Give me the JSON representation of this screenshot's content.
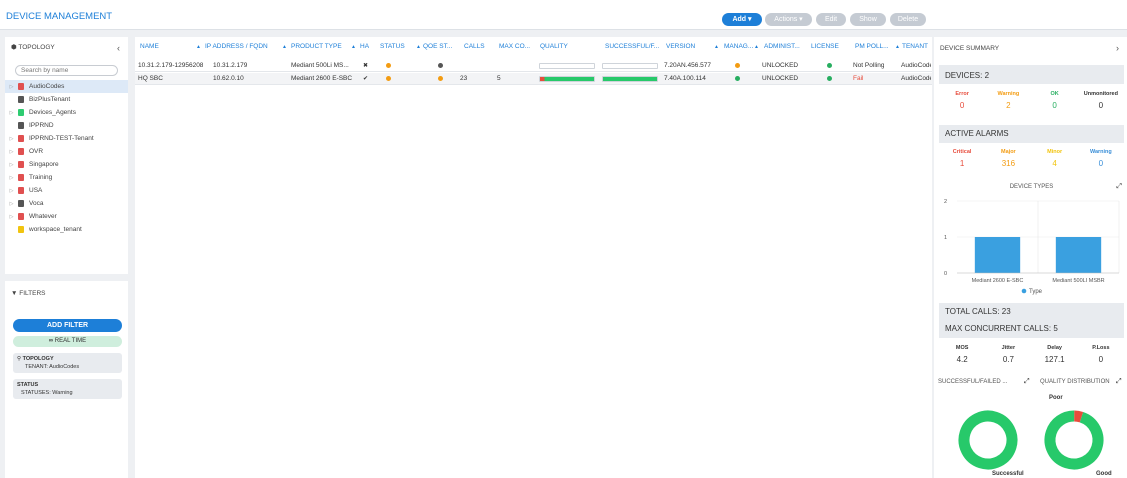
{
  "page_title": "DEVICE MANAGEMENT",
  "toolbar": {
    "add": "Add ▾",
    "actions": "Actions ▾",
    "edit": "Edit",
    "show": "Show",
    "delete": "Delete"
  },
  "topology": {
    "title": "TOPOLOGY",
    "search_placeholder": "Search by name",
    "items": [
      {
        "label": "AudioCodes",
        "color": "#e05050",
        "expand": true,
        "selected": true
      },
      {
        "label": "BizPlusTenant",
        "color": "#555555",
        "expand": false
      },
      {
        "label": "Devices_Agents",
        "color": "#2ecc71",
        "expand": true
      },
      {
        "label": "IPPRND",
        "color": "#555555",
        "expand": false
      },
      {
        "label": "IPPRND-TEST-Tenant",
        "color": "#e05050",
        "expand": true
      },
      {
        "label": "OVR",
        "color": "#e05050",
        "expand": true
      },
      {
        "label": "Singapore",
        "color": "#e05050",
        "expand": true
      },
      {
        "label": "Training",
        "color": "#e05050",
        "expand": true
      },
      {
        "label": "USA",
        "color": "#e05050",
        "expand": true
      },
      {
        "label": "Voca",
        "color": "#555555",
        "expand": true
      },
      {
        "label": "Whatever",
        "color": "#e05050",
        "expand": true
      },
      {
        "label": "workspace_tenant",
        "color": "#f1c40f",
        "expand": false
      }
    ]
  },
  "filters": {
    "title": "FILTERS",
    "add_filter": "ADD FILTER",
    "realtime": "REAL TIME",
    "chip1_title": "TOPOLOGY",
    "chip1_value": "TENANT: AudioCodes",
    "chip2_title": "STATUS",
    "chip2_value": "STATUSES: Warning"
  },
  "table": {
    "headers": [
      "NAME",
      "IP ADDRESS / FQDN",
      "PRODUCT TYPE",
      "HA",
      "STATUS",
      "QOE ST...",
      "CALLS",
      "MAX CO...",
      "QUALITY",
      "SUCCESSFUL/F...",
      "VERSION",
      "MANAG...",
      "ADMINIST...",
      "LICENSE",
      "PM POLL...",
      "TENANT"
    ],
    "rows": [
      {
        "name": "10.31.2.179-12956208",
        "ip": "10.31.2.179",
        "product": "Mediant 500Li MS...",
        "ha": "✖",
        "status_color": "#f39c12",
        "qoe_color": "#555555",
        "calls": "",
        "max": "",
        "quality": 0,
        "successful": 0,
        "version": "7.20AN.456.577",
        "manag_color": "#f39c12",
        "admin": "UNLOCKED",
        "license_color": "#27ae60",
        "pm": "Not Polling",
        "pm_color": "#333333",
        "tenant": "AudioCodes"
      },
      {
        "name": "HQ SBC",
        "ip": "10.62.0.10",
        "product": "Mediant 2600 E-SBC",
        "ha": "✔",
        "status_color": "#f39c12",
        "qoe_color": "#f39c12",
        "calls": "23",
        "max": "5",
        "quality": 1,
        "successful": 1,
        "version": "7.40A.100.114",
        "manag_color": "#27ae60",
        "admin": "UNLOCKED",
        "license_color": "#27ae60",
        "pm": "Fail",
        "pm_color": "#e74c3c",
        "tenant": "AudioCodes"
      }
    ]
  },
  "summary": {
    "title": "DEVICE SUMMARY",
    "devices_label": "DEVICES: 2",
    "device_stats": [
      {
        "k": "Error",
        "v": "0",
        "color": "#e74c3c"
      },
      {
        "k": "Warning",
        "v": "2",
        "color": "#f39c12"
      },
      {
        "k": "OK",
        "v": "0",
        "color": "#27ae60"
      },
      {
        "k": "Unmonitored",
        "v": "0",
        "color": "#333333"
      }
    ],
    "alarms_label": "ACTIVE ALARMS",
    "alarm_stats": [
      {
        "k": "Critical",
        "v": "1",
        "color": "#e74c3c"
      },
      {
        "k": "Major",
        "v": "316",
        "color": "#f39c12"
      },
      {
        "k": "Minor",
        "v": "4",
        "color": "#f1c40f"
      },
      {
        "k": "Warning",
        "v": "0",
        "color": "#3a8fd8"
      }
    ],
    "device_types_title": "DEVICE TYPES",
    "total_calls": "TOTAL CALLS: 23",
    "max_calls": "MAX CONCURRENT CALLS: 5",
    "qoe_stats": [
      {
        "k": "MOS",
        "v": "4.2"
      },
      {
        "k": "Jitter",
        "v": "0.7"
      },
      {
        "k": "Delay",
        "v": "127.1"
      },
      {
        "k": "P.Loss",
        "v": "0"
      }
    ],
    "successful_title": "SUCCESSFUL/FAILED ...",
    "quality_title": "QUALITY DISTRIBUTION"
  },
  "chart_data": [
    {
      "type": "bar",
      "title": "DEVICE TYPES",
      "categories": [
        "Mediant 2600 E-SBC",
        "Mediant 500LI MSBR"
      ],
      "series": [
        {
          "name": "Type",
          "values": [
            1,
            1
          ]
        }
      ],
      "ylim": [
        0,
        2
      ],
      "yticks": [
        "0",
        "1",
        "2"
      ],
      "color": "#3aa0e0"
    },
    {
      "type": "pie",
      "title": "SUCCESSFUL/FAILED ...",
      "labels": [
        "Successful"
      ],
      "values": [
        100
      ],
      "colors": [
        "#27c96a"
      ]
    },
    {
      "type": "pie",
      "title": "QUALITY DISTRIBUTION",
      "labels": [
        "Good",
        "Poor"
      ],
      "values": [
        95,
        5
      ],
      "colors": [
        "#27c96a",
        "#e74c3c"
      ]
    }
  ]
}
